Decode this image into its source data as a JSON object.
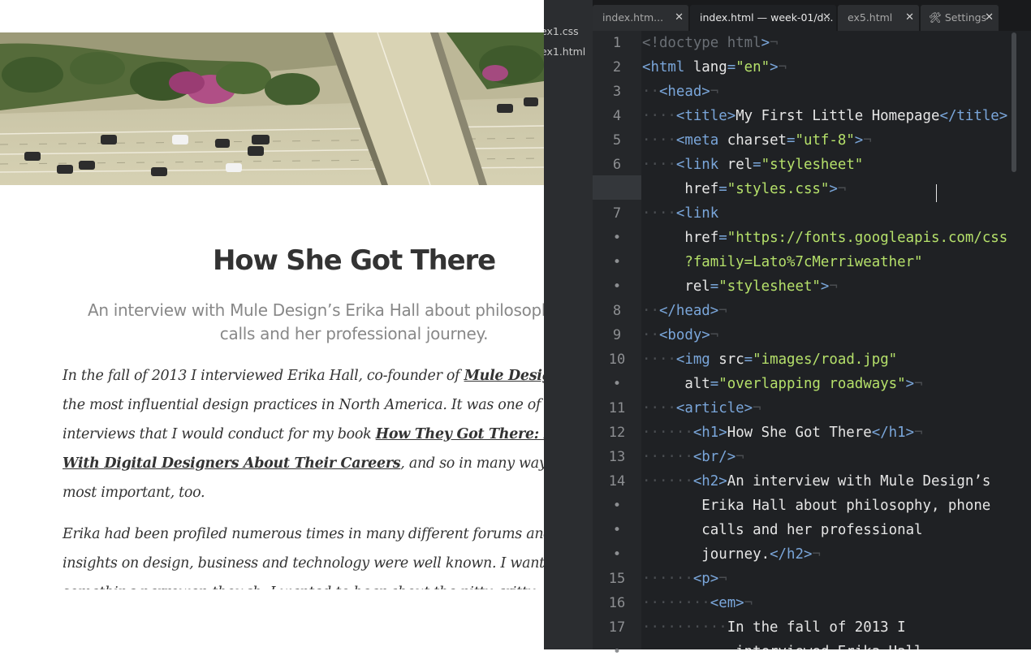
{
  "preview": {
    "title": "How She Got There",
    "subtitle": "An interview with Mule Design’s Erika Hall about philosophy, phone calls and her professional journey.",
    "para1": {
      "lead": "In the fall of 2013 I interviewed Erika Hall, co-founder of ",
      "link1": "Mule Design",
      "mid": ", one of the most influential design practices in North America. It was one of fourteen interviews that I would conduct for my book ",
      "link2": "How They Got There: Interviews With Digital Designers About Their Careers",
      "tail": ", and so in many ways was the most important, too."
    },
    "para2": "Erika had been profiled numerous times in many different forums and her insights on design, business and technology were well known. I wanted something narrower, though. I wanted to hear about the nitty gritty",
    "hero_alt": "overlapping roadways"
  },
  "sidebar": {
    "files": [
      "ex1.css",
      "ex1.html"
    ]
  },
  "tabs": [
    {
      "label": "index.htm...",
      "active": false
    },
    {
      "label": "index.html — week-01/d...",
      "active": true
    },
    {
      "label": "ex5.html",
      "active": false
    },
    {
      "label": "Settings",
      "active": false,
      "icon": "wrench-screwdriver-icon"
    }
  ],
  "gutter": [
    "1",
    "2",
    "3",
    "4",
    "5",
    "6",
    "•",
    "7",
    "•",
    "•",
    "•",
    "8",
    "9",
    "10",
    "•",
    "11",
    "12",
    "13",
    "14",
    "•",
    "•",
    "•",
    "15",
    "16",
    "17",
    "•"
  ],
  "current_line_index": 6,
  "code_lines": [
    [
      [
        "w",
        ""
      ],
      [
        "dt",
        "<!doctype html"
      ],
      [
        "t",
        ">"
      ],
      [
        "w",
        "¬"
      ]
    ],
    [
      [
        "t",
        "<html "
      ],
      [
        "a",
        "lang"
      ],
      [
        "t",
        "="
      ],
      [
        "s",
        "\"en\""
      ],
      [
        "t",
        ">"
      ],
      [
        "w",
        "¬"
      ]
    ],
    [
      [
        "w",
        "··"
      ],
      [
        "t",
        "<head>"
      ],
      [
        "w",
        "¬"
      ]
    ],
    [
      [
        "w",
        "····"
      ],
      [
        "t",
        "<title>"
      ],
      [
        "a",
        "My First Little Homepage"
      ],
      [
        "t",
        "</title>"
      ]
    ],
    [
      [
        "w",
        "····"
      ],
      [
        "t",
        "<meta "
      ],
      [
        "a",
        "charset"
      ],
      [
        "t",
        "="
      ],
      [
        "s",
        "\"utf-8\""
      ],
      [
        "t",
        ">"
      ],
      [
        "w",
        "¬"
      ]
    ],
    [
      [
        "w",
        "····"
      ],
      [
        "t",
        "<link "
      ],
      [
        "a",
        "rel"
      ],
      [
        "t",
        "="
      ],
      [
        "s",
        "\"stylesheet\""
      ]
    ],
    [
      [
        "w",
        "     "
      ],
      [
        "a",
        "href"
      ],
      [
        "t",
        "="
      ],
      [
        "s",
        "\"styles.css\""
      ],
      [
        "t",
        ">"
      ],
      [
        "w",
        "¬"
      ]
    ],
    [
      [
        "w",
        "····"
      ],
      [
        "t",
        "<link"
      ]
    ],
    [
      [
        "w",
        "     "
      ],
      [
        "a",
        "href"
      ],
      [
        "t",
        "="
      ],
      [
        "s",
        "\"https://fonts.googleapis.com/css"
      ]
    ],
    [
      [
        "w",
        "     "
      ],
      [
        "s",
        "?family=Lato%7cMerriweather\""
      ]
    ],
    [
      [
        "w",
        "     "
      ],
      [
        "a",
        "rel"
      ],
      [
        "t",
        "="
      ],
      [
        "s",
        "\"stylesheet\""
      ],
      [
        "t",
        ">"
      ],
      [
        "w",
        "¬"
      ]
    ],
    [
      [
        "w",
        "··"
      ],
      [
        "t",
        "</head>"
      ],
      [
        "w",
        "¬"
      ]
    ],
    [
      [
        "w",
        "··"
      ],
      [
        "t",
        "<body>"
      ],
      [
        "w",
        "¬"
      ]
    ],
    [
      [
        "w",
        "····"
      ],
      [
        "t",
        "<img "
      ],
      [
        "a",
        "src"
      ],
      [
        "t",
        "="
      ],
      [
        "s",
        "\"images/road.jpg\""
      ]
    ],
    [
      [
        "w",
        "     "
      ],
      [
        "a",
        "alt"
      ],
      [
        "t",
        "="
      ],
      [
        "s",
        "\"overlapping roadways\""
      ],
      [
        "t",
        ">"
      ],
      [
        "w",
        "¬"
      ]
    ],
    [
      [
        "w",
        "····"
      ],
      [
        "t",
        "<article>"
      ],
      [
        "w",
        "¬"
      ]
    ],
    [
      [
        "w",
        "······"
      ],
      [
        "t",
        "<h1>"
      ],
      [
        "a",
        "How She Got There"
      ],
      [
        "t",
        "</h1>"
      ],
      [
        "w",
        "¬"
      ]
    ],
    [
      [
        "w",
        "······"
      ],
      [
        "t",
        "<br/>"
      ],
      [
        "w",
        "¬"
      ]
    ],
    [
      [
        "w",
        "······"
      ],
      [
        "t",
        "<h2>"
      ],
      [
        "a",
        "An interview with Mule Design’s"
      ]
    ],
    [
      [
        "w",
        "       "
      ],
      [
        "a",
        "Erika Hall about philosophy, phone"
      ]
    ],
    [
      [
        "w",
        "       "
      ],
      [
        "a",
        "calls and her professional"
      ]
    ],
    [
      [
        "w",
        "       "
      ],
      [
        "a",
        "journey."
      ],
      [
        "t",
        "</h2>"
      ],
      [
        "w",
        "¬"
      ]
    ],
    [
      [
        "w",
        "······"
      ],
      [
        "t",
        "<p>"
      ],
      [
        "w",
        "¬"
      ]
    ],
    [
      [
        "w",
        "········"
      ],
      [
        "t",
        "<em>"
      ],
      [
        "w",
        "¬"
      ]
    ],
    [
      [
        "w",
        "··········"
      ],
      [
        "a",
        "In the fall of 2013 I"
      ]
    ],
    [
      [
        "w",
        "           "
      ],
      [
        "a",
        "interviewed Erika Hall,"
      ]
    ]
  ]
}
